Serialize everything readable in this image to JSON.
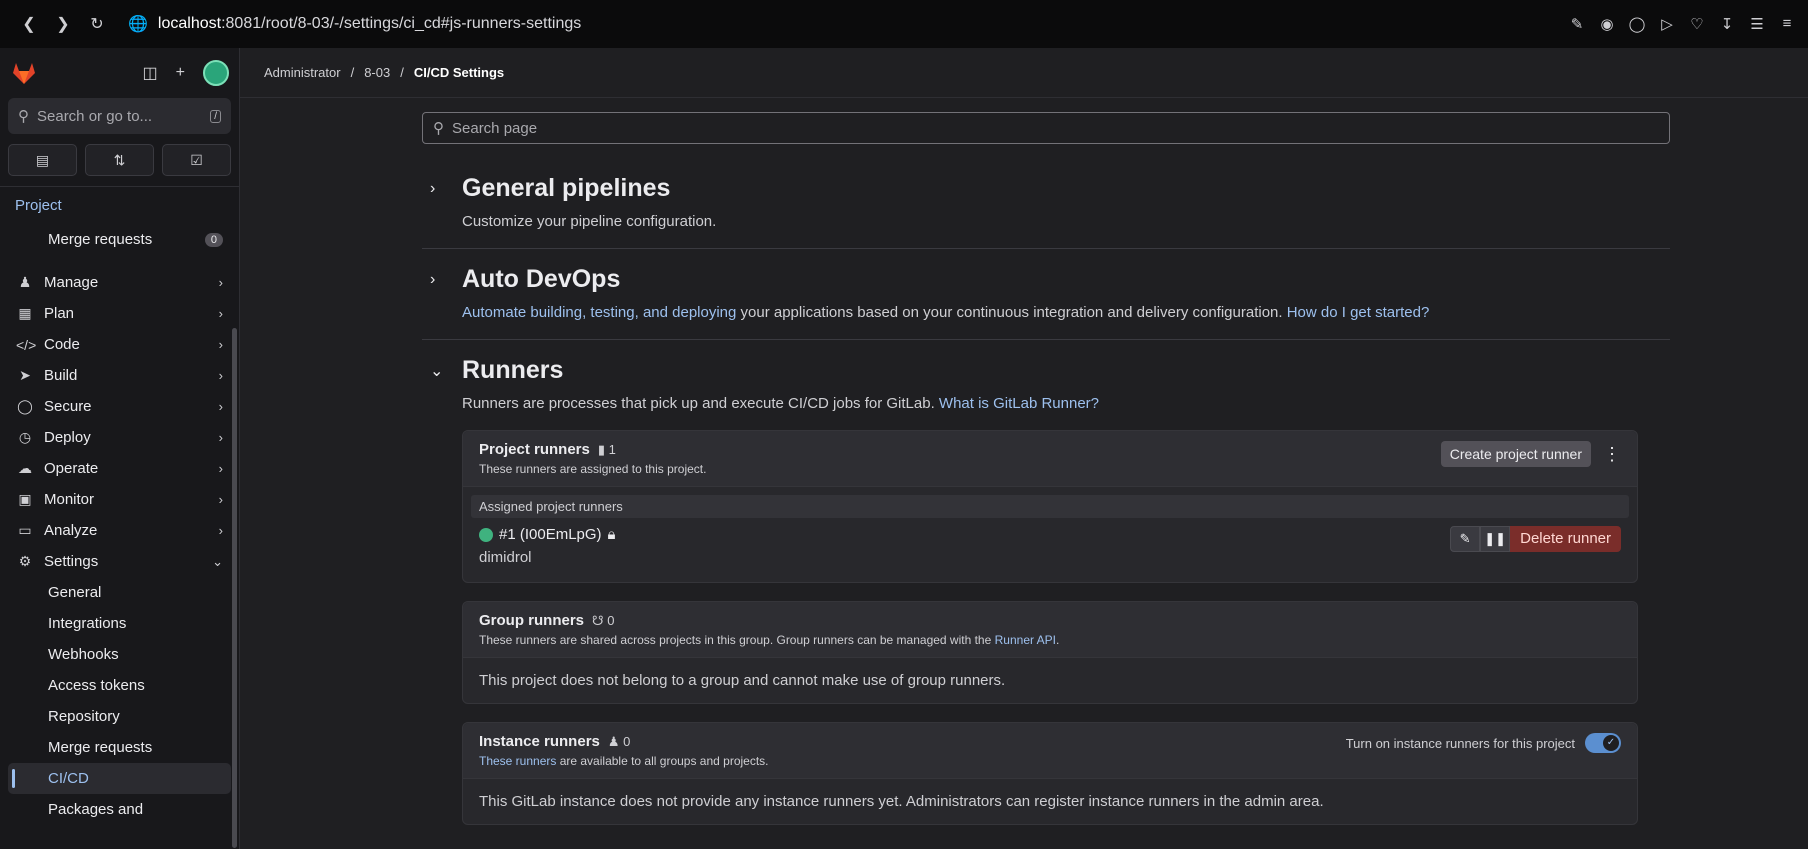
{
  "browser": {
    "url_host": "localhost",
    "url_path": ":8081/root/8-03/-/settings/ci_cd#js-runners-settings"
  },
  "sidebar": {
    "search_placeholder": "Search or go to...",
    "search_shortcut": "/",
    "section_label": "Project",
    "merge_requests_label": "Merge requests",
    "merge_requests_count": "0",
    "nav": [
      {
        "label": "Manage"
      },
      {
        "label": "Plan"
      },
      {
        "label": "Code"
      },
      {
        "label": "Build"
      },
      {
        "label": "Secure"
      },
      {
        "label": "Deploy"
      },
      {
        "label": "Operate"
      },
      {
        "label": "Monitor"
      },
      {
        "label": "Analyze"
      },
      {
        "label": "Settings"
      }
    ],
    "settings_sub": [
      {
        "label": "General"
      },
      {
        "label": "Integrations"
      },
      {
        "label": "Webhooks"
      },
      {
        "label": "Access tokens"
      },
      {
        "label": "Repository"
      },
      {
        "label": "Merge requests"
      },
      {
        "label": "CI/CD"
      },
      {
        "label": "Packages and"
      }
    ]
  },
  "breadcrumbs": {
    "b1": "Administrator",
    "b2": "8-03",
    "b3": "CI/CD Settings",
    "sep": "/"
  },
  "search_page": {
    "placeholder": "Search page"
  },
  "sections": {
    "general": {
      "title": "General pipelines",
      "desc": "Customize your pipeline configuration."
    },
    "autodevops": {
      "title": "Auto DevOps",
      "link1": "Automate building, testing, and deploying",
      "desc_mid": " your applications based on your continuous integration and delivery configuration. ",
      "link2": "How do I get started?"
    },
    "runners": {
      "title": "Runners",
      "desc": "Runners are processes that pick up and execute CI/CD jobs for GitLab. ",
      "link": "What is GitLab Runner?"
    }
  },
  "project_runners": {
    "title": "Project runners",
    "count": "1",
    "subtitle": "These runners are assigned to this project.",
    "create_button": "Create project runner",
    "assigned_label": "Assigned project runners",
    "runner_name": "#1 (I00EmLpG)",
    "runner_desc": "dimidrol",
    "delete_button": "Delete runner"
  },
  "group_runners": {
    "title": "Group runners",
    "count": "0",
    "subtitle_pre": "These runners are shared across projects in this group. Group runners can be managed with the ",
    "subtitle_link": "Runner API",
    "subtitle_post": ".",
    "body": "This project does not belong to a group and cannot make use of group runners."
  },
  "instance_runners": {
    "title": "Instance runners",
    "count": "0",
    "subtitle_link": "These runners",
    "subtitle_post": " are available to all groups and projects.",
    "toggle_label": "Turn on instance runners for this project",
    "body": "This GitLab instance does not provide any instance runners yet. Administrators can register instance runners in the admin area."
  }
}
